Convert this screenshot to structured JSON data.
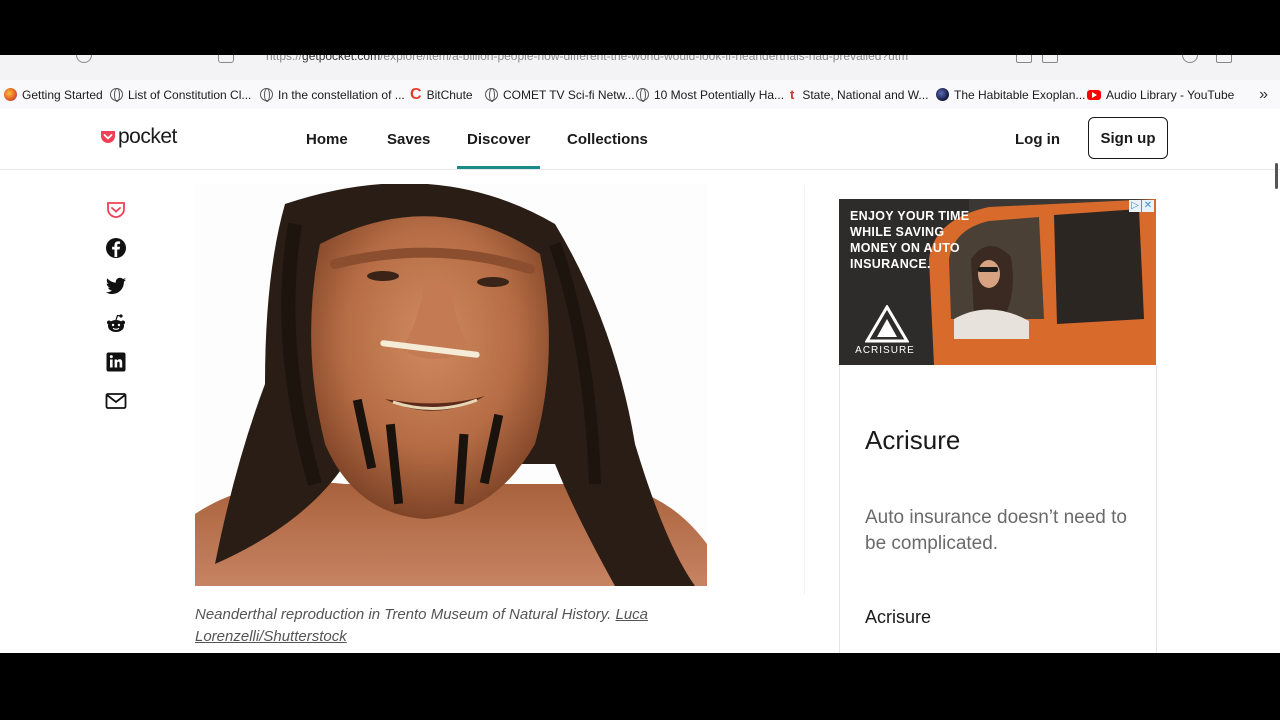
{
  "browser": {
    "url_domain": "getpocket.com",
    "url_rest": "/explore/item/a-billion-people-how-different-the-world-would-look-if-neanderthals-had-prevailed?utm"
  },
  "bookmarks": [
    {
      "label": "Getting Started",
      "icon": "firefox-icon"
    },
    {
      "label": "List of Constitution Cl...",
      "icon": "globe-icon"
    },
    {
      "label": "In the constellation of ...",
      "icon": "globe-icon"
    },
    {
      "label": "BitChute",
      "icon": "bitchute-icon"
    },
    {
      "label": "COMET TV Sci-fi Netw...",
      "icon": "globe-icon"
    },
    {
      "label": "10 Most Potentially Ha...",
      "icon": "globe-icon"
    },
    {
      "label": "State, National and W...",
      "icon": "t-icon"
    },
    {
      "label": "The Habitable Exoplan...",
      "icon": "exoplanet-icon"
    },
    {
      "label": "Audio Library - YouTube",
      "icon": "youtube-icon"
    }
  ],
  "header": {
    "logo": "pocket",
    "nav": [
      "Home",
      "Saves",
      "Discover",
      "Collections"
    ],
    "active_nav": "Discover",
    "login": "Log in",
    "signup": "Sign up"
  },
  "share": [
    "pocket-save-icon",
    "facebook-icon",
    "twitter-icon",
    "reddit-icon",
    "linkedin-icon",
    "email-icon"
  ],
  "article": {
    "caption": "Neanderthal reproduction in Trento Museum of Natural History.",
    "credit": "Luca Lorenzelli/Shutterstock"
  },
  "ad": {
    "banner_text": "ENJOY YOUR TIME WHILE SAVING MONEY ON AUTO INSURANCE.",
    "banner_brand": "ACRISURE",
    "title": "Acrisure",
    "description": "Auto insurance doesn’t need to be complicated.",
    "brand": "Acrisure"
  },
  "colors": {
    "pocket_red": "#ef4056",
    "active_underline": "#1a8b88"
  }
}
